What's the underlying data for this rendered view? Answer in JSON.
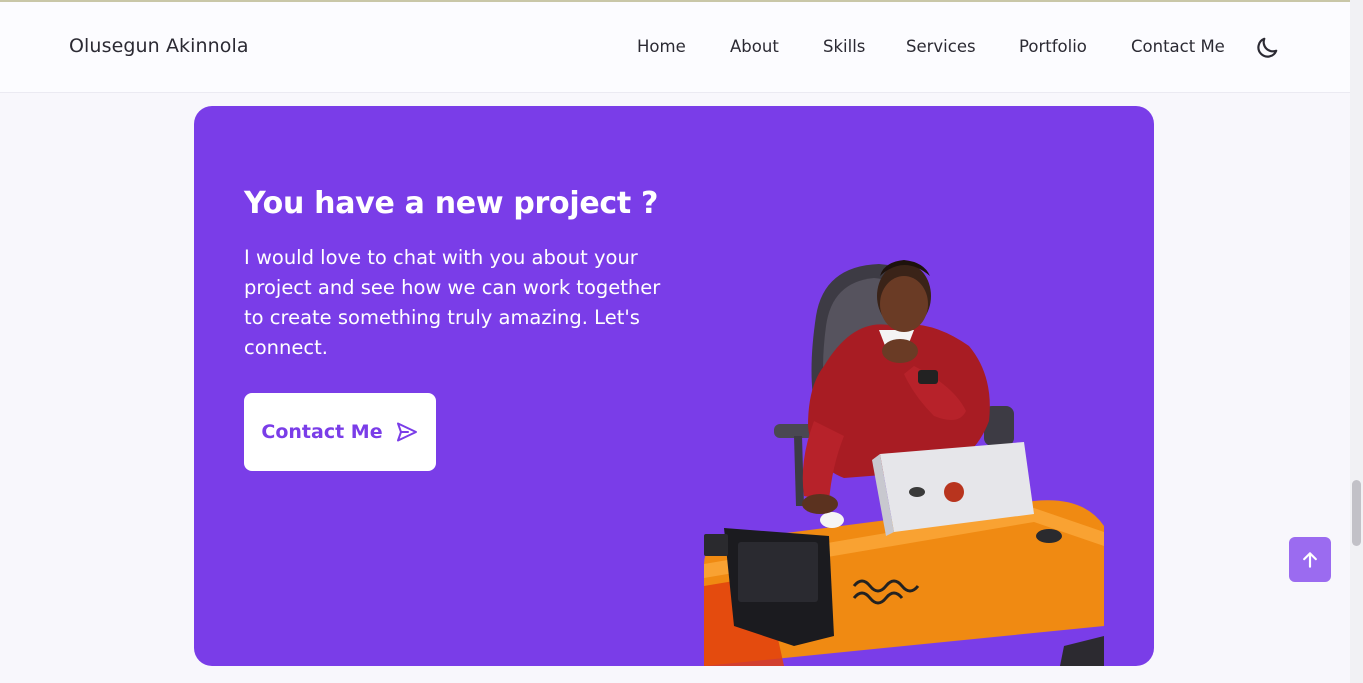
{
  "header": {
    "brand": "Olusegun Akinnola",
    "nav": [
      {
        "label": "Home"
      },
      {
        "label": "About"
      },
      {
        "label": "Skills"
      },
      {
        "label": "Services"
      },
      {
        "label": "Portfolio"
      },
      {
        "label": "Contact Me"
      }
    ],
    "theme_toggle_icon": "moon-icon"
  },
  "contact_card": {
    "title": "You have a new project ?",
    "text": "I would love to chat with you about your project and see how we can work together to create something truly amazing. Let's connect.",
    "button_label": "Contact Me",
    "button_icon": "send-icon",
    "photo_alt": "photo of person at desk with laptop"
  },
  "scroll_top_icon": "arrow-up-icon",
  "colors": {
    "accent": "#7a3de8",
    "scroll_top": "#9b6bf0",
    "background": "#f8f7fc"
  }
}
